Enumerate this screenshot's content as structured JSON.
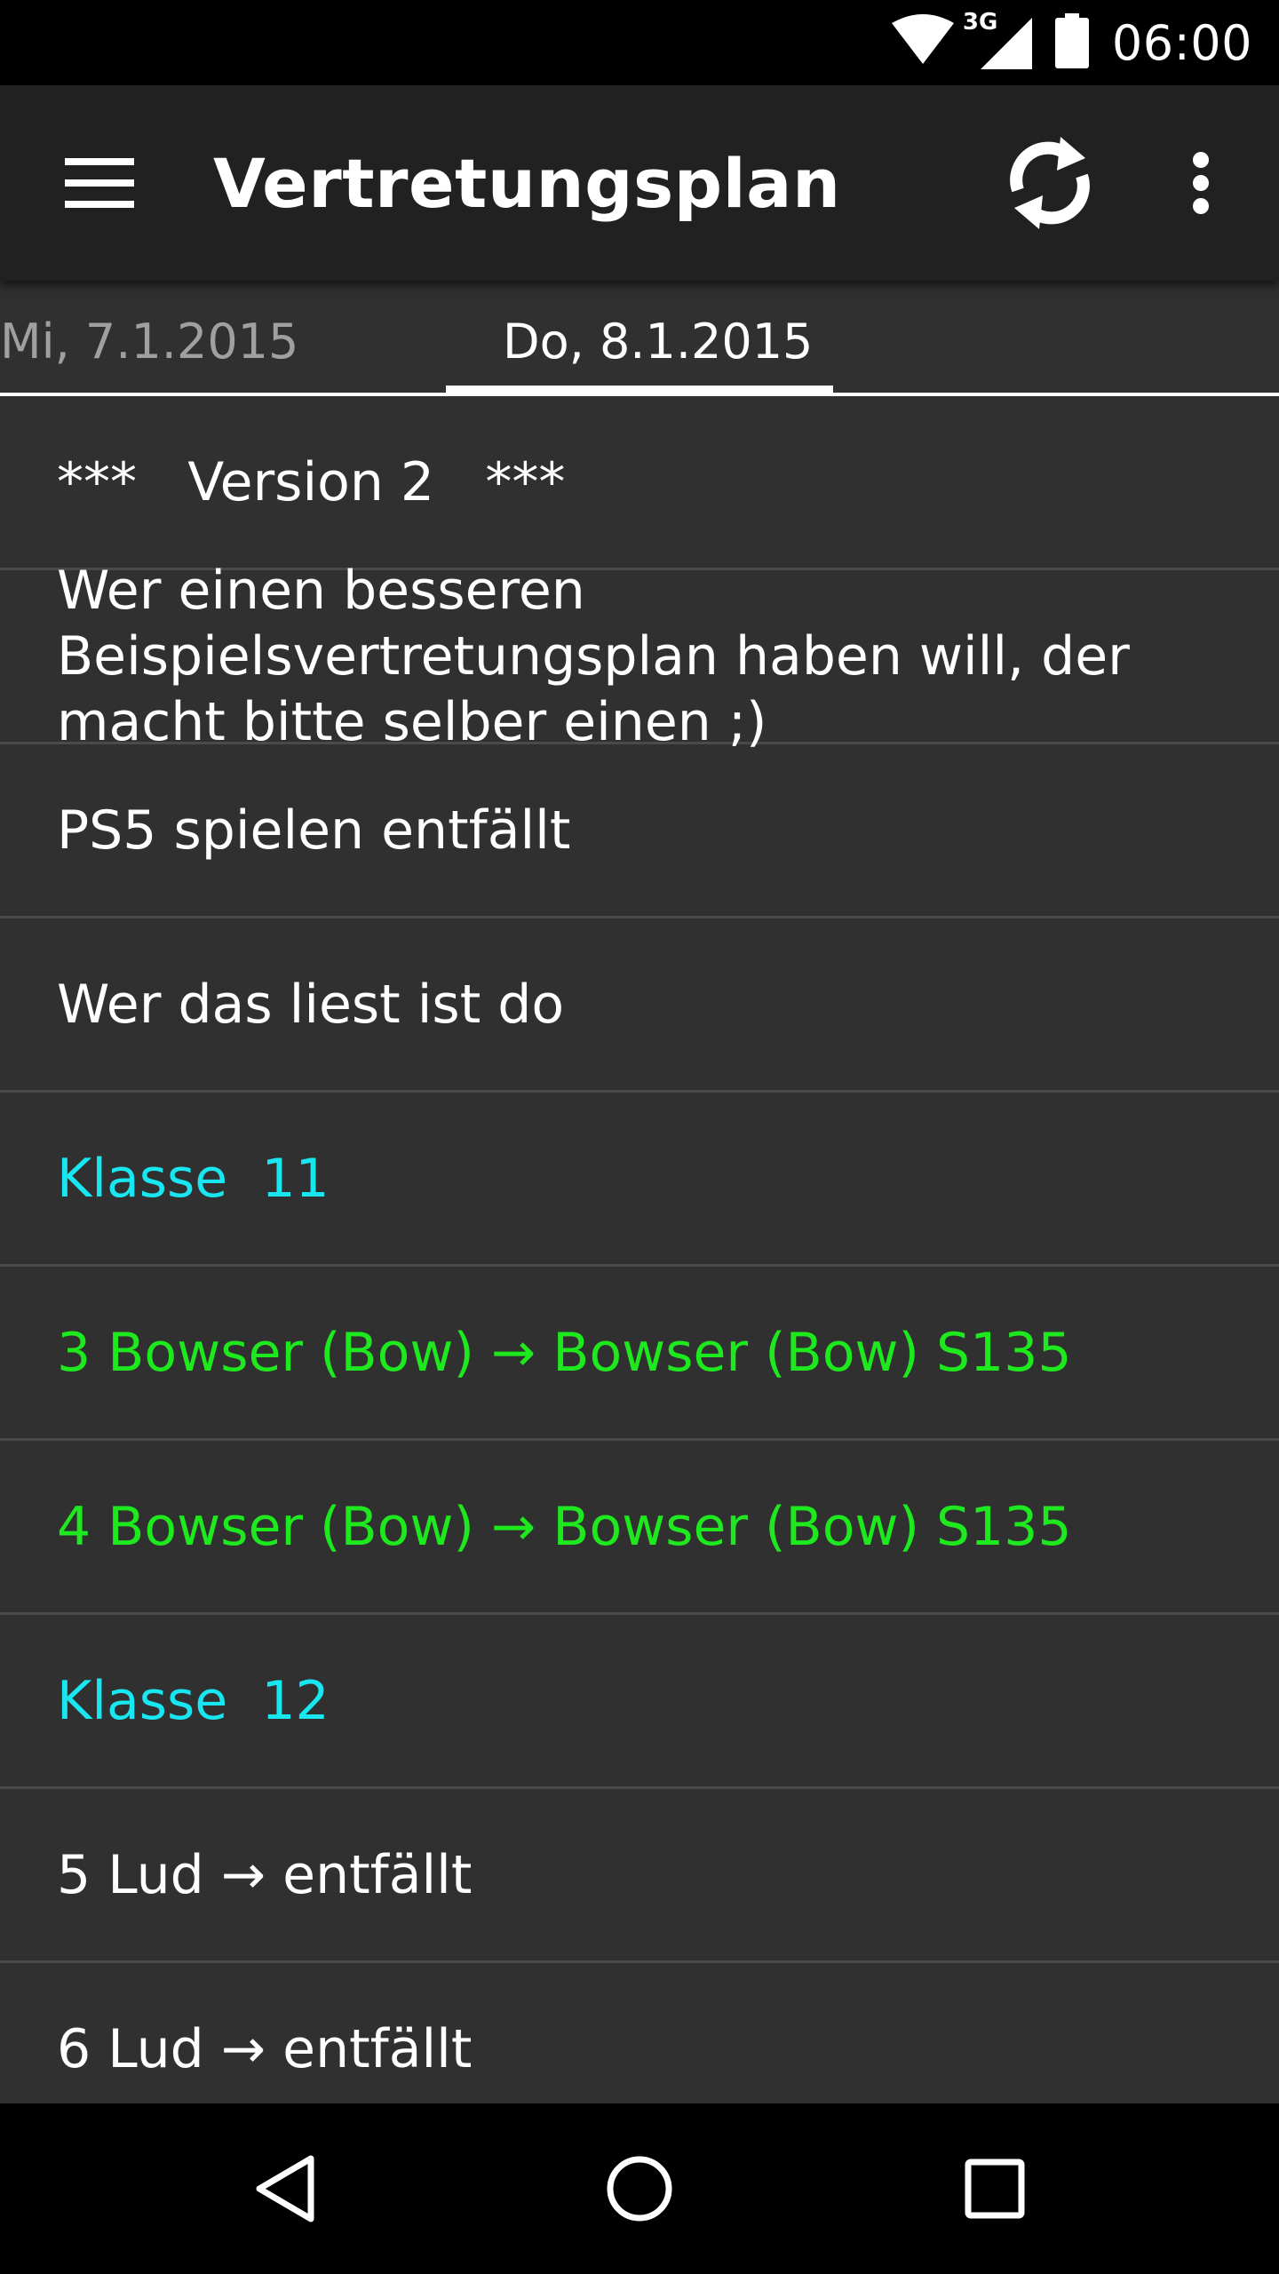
{
  "status_bar": {
    "network_label": "3G",
    "time": "06:00"
  },
  "toolbar": {
    "title": "Vertretungsplan"
  },
  "tabs": [
    {
      "label": "Mi, 7.1.2015",
      "selected": false
    },
    {
      "label": "Do, 8.1.2015",
      "selected": true
    }
  ],
  "entries": [
    {
      "text": "***   Version 2   ***",
      "kind": "info"
    },
    {
      "text": "Wer einen besseren Beispielsvertretungsplan haben will, der macht bitte selber einen ;)",
      "kind": "info"
    },
    {
      "text": "PS5 spielen entfällt",
      "kind": "info"
    },
    {
      "text": "Wer das liest ist do",
      "kind": "info"
    },
    {
      "text": "Klasse  11",
      "kind": "class-header"
    },
    {
      "text": "3 Bowser (Bow) → Bowser (Bow) S135",
      "kind": "change"
    },
    {
      "text": "4 Bowser (Bow) → Bowser (Bow) S135",
      "kind": "change"
    },
    {
      "text": "Klasse  12",
      "kind": "class-header"
    },
    {
      "text": "5 Lud → entfällt",
      "kind": "info"
    },
    {
      "text": "6 Lud → entfällt",
      "kind": "info"
    }
  ],
  "colors": {
    "toolbar": "#212121",
    "background": "#303030",
    "class_header": "#18e6f0",
    "change": "#1ee81e"
  },
  "icons": {
    "menu": "hamburger-menu-icon",
    "refresh": "refresh-icon",
    "overflow": "more-vert-icon",
    "back": "back-triangle-icon",
    "home": "home-circle-icon",
    "recents": "recents-square-icon"
  }
}
